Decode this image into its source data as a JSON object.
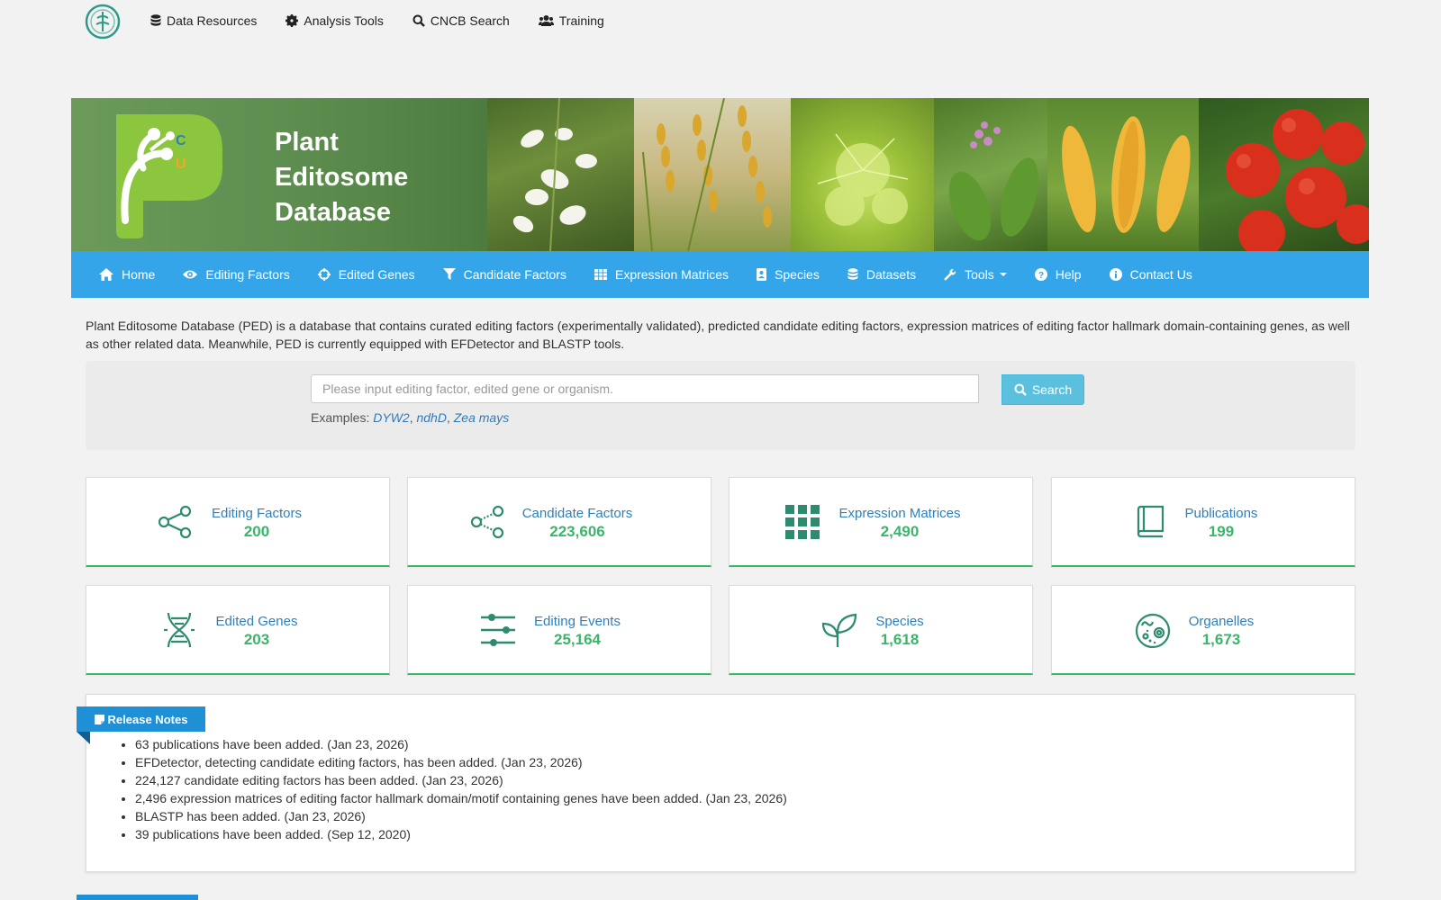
{
  "topnav": {
    "items": [
      {
        "label": "Data Resources",
        "icon": "database-icon"
      },
      {
        "label": "Analysis Tools",
        "icon": "gear-icon"
      },
      {
        "label": "CNCB Search",
        "icon": "search-icon"
      },
      {
        "label": "Training",
        "icon": "users-icon"
      }
    ]
  },
  "banner": {
    "title_line1": "Plant",
    "title_line2": "Editosome",
    "title_line3": "Database",
    "logo_letters": [
      "C",
      "U"
    ]
  },
  "mainnav": {
    "items": [
      {
        "label": "Home",
        "icon": "home-icon"
      },
      {
        "label": "Editing Factors",
        "icon": "eye-icon"
      },
      {
        "label": "Edited Genes",
        "icon": "crosshair-icon"
      },
      {
        "label": "Candidate Factors",
        "icon": "filter-icon"
      },
      {
        "label": "Expression Matrices",
        "icon": "table-icon"
      },
      {
        "label": "Species",
        "icon": "id-card-icon"
      },
      {
        "label": "Datasets",
        "icon": "database-icon"
      },
      {
        "label": "Tools",
        "icon": "wrench-icon"
      },
      {
        "label": "Help",
        "icon": "question-icon"
      },
      {
        "label": "Contact Us",
        "icon": "info-icon"
      }
    ]
  },
  "intro": "Plant Editosome Database (PED) is a database that contains curated editing factors (experimentally validated), predicted candidate editing factors, expression matrices of editing factor hallmark domain-containing genes, as well as other related data. Meanwhile, PED is currently equipped with EFDetector and BLASTP tools.",
  "search": {
    "placeholder": "Please input editing factor, edited gene or organism.",
    "button": "Search",
    "examples_label": "Examples:",
    "examples": [
      "DYW2",
      "ndhD",
      "Zea mays"
    ]
  },
  "stats": [
    {
      "label": "Editing Factors",
      "value": "200",
      "icon": "share-icon"
    },
    {
      "label": "Candidate Factors",
      "value": "223,606",
      "icon": "share-dotted-icon"
    },
    {
      "label": "Expression Matrices",
      "value": "2,490",
      "icon": "grid-icon"
    },
    {
      "label": "Publications",
      "value": "199",
      "icon": "book-icon"
    },
    {
      "label": "Edited Genes",
      "value": "203",
      "icon": "dna-icon"
    },
    {
      "label": "Editing Events",
      "value": "25,164",
      "icon": "sliders-icon"
    },
    {
      "label": "Species",
      "value": "1,618",
      "icon": "sprout-icon"
    },
    {
      "label": "Organelles",
      "value": "1,673",
      "icon": "cell-icon"
    }
  ],
  "release_notes": {
    "title": "Release Notes",
    "items": [
      "63 publications have been added. (Jan 23, 2026)",
      "EFDetector, detecting candidate editing factors, has been added. (Jan 23, 2026)",
      "224,127 candidate editing factors has been added. (Jan 23, 2026)",
      "2,496 expression matrices of editing factor hallmark domain/motif containing genes have been added. (Jan 23, 2026)",
      "BLASTP has been added. (Jan 23, 2026)",
      "39 publications have been added. (Sep 12, 2020)"
    ]
  },
  "colors": {
    "nav": "#33a5e8",
    "accent_green": "#3bb56a",
    "link_blue": "#2f7fb8",
    "icon_teal": "#2e8b6f"
  }
}
